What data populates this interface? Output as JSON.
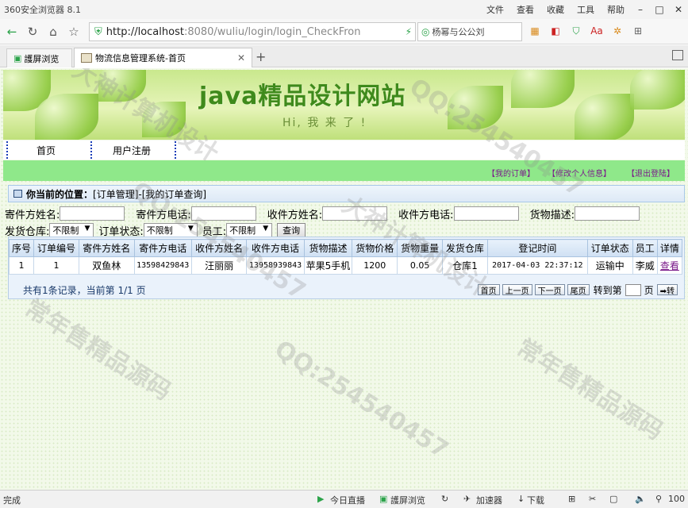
{
  "browser": {
    "app_name": "360安全浏览器 8.1",
    "menu": [
      "文件",
      "查看",
      "收藏",
      "工具",
      "帮助"
    ],
    "url_host": "http://localhost",
    "url_rest": ":8080/wuliu/login/login_CheckFron",
    "search_text": "杨幂与公公刘",
    "tabs": [
      {
        "label": "護屏浏览"
      },
      {
        "label": "物流信息管理系统-首页"
      }
    ],
    "status_left": "完成",
    "status_items": [
      "今日直播",
      "護屏浏览",
      "加速器",
      "下载"
    ],
    "zoom": "100"
  },
  "page": {
    "banner_title": "java精品设计网站",
    "banner_sub": "Hi,  我  来 了 !",
    "nav": [
      "首页",
      "用户注册"
    ],
    "user_links": [
      "【我的订单】",
      "【修改个人信息】",
      "【退出登陆】"
    ],
    "location_label": "你当前的位置：",
    "location_path": "[订单管理]-[我的订单查询]",
    "filters": {
      "sender_name": "寄件方姓名:",
      "sender_phone": "寄件方电话:",
      "receiver_name": "收件方姓名:",
      "receiver_phone": "收件方电话:",
      "goods_desc": "货物描述:",
      "warehouse": "发货仓库:",
      "order_status": "订单状态:",
      "employee": "员工:",
      "any": "不限制",
      "query": "查询"
    },
    "table": {
      "headers": [
        "序号",
        "订单编号",
        "寄件方姓名",
        "寄件方电话",
        "收件方姓名",
        "收件方电话",
        "货物描述",
        "货物价格",
        "货物重量",
        "发货仓库",
        "登记时间",
        "订单状态",
        "员工",
        "详情"
      ],
      "rows": [
        [
          "1",
          "1",
          "双鱼林",
          "13598429843",
          "汪丽丽",
          "13958939843",
          "苹果5手机",
          "1200",
          "0.05",
          "仓库1",
          "2017-04-03 22:37:12",
          "运输中",
          "李威",
          "查看"
        ]
      ]
    },
    "pager": {
      "info": "共有1条记录，当前第 1/1 页",
      "first": "首页",
      "prev": "上一页",
      "next": "下一页",
      "last": "尾页",
      "goto": "转到第",
      "page_unit": "页",
      "go": "➡转"
    }
  },
  "watermarks": [
    "大神计算机设计",
    "QQ:254540457",
    "常年售精品源码"
  ]
}
